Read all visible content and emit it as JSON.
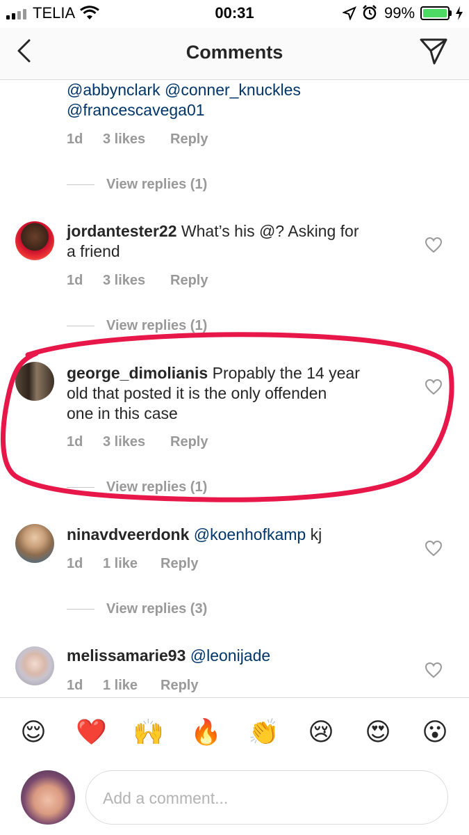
{
  "status_bar": {
    "carrier": "TELIA",
    "time": "00:31",
    "battery": "99%"
  },
  "header": {
    "title": "Comments"
  },
  "comments": [
    {
      "text_lines": [
        "@abbynclark @conner_knuckles",
        "@francescavega01"
      ],
      "time": "1d",
      "likes": "3 likes",
      "reply": "Reply",
      "view_replies": "View replies (1)"
    },
    {
      "username": "jordantester22",
      "text_first": "What’s his @? Asking for",
      "text_second": "a friend",
      "time": "1d",
      "likes": "3 likes",
      "reply": "Reply",
      "view_replies": "View replies (1)"
    },
    {
      "username": "george_dimolianis",
      "text_first": "Propably the 14 year",
      "text_second": "old that posted it is the only offenden",
      "text_third": "one in this case",
      "time": "1d",
      "likes": "3 likes",
      "reply": "Reply",
      "view_replies": "View replies (1)"
    },
    {
      "username": "ninavdveerdonk",
      "mention": "@koenhofkamp",
      "text_after": "kj",
      "time": "1d",
      "likes": "1 like",
      "reply": "Reply",
      "view_replies": "View replies (3)"
    },
    {
      "username": "melissamarie93",
      "mention": "@leonijade",
      "time": "1d",
      "likes": "1 like",
      "reply": "Reply"
    }
  ],
  "emoji_bar": [
    "😌",
    "❤️",
    "🙌",
    "🔥",
    "👏",
    "😢",
    "😍",
    "😮"
  ],
  "composer": {
    "placeholder": "Add a comment..."
  },
  "colors": {
    "highlight_circle": "#e8174a",
    "mention": "#003569",
    "meta": "#999999",
    "battery": "#4cd964"
  }
}
